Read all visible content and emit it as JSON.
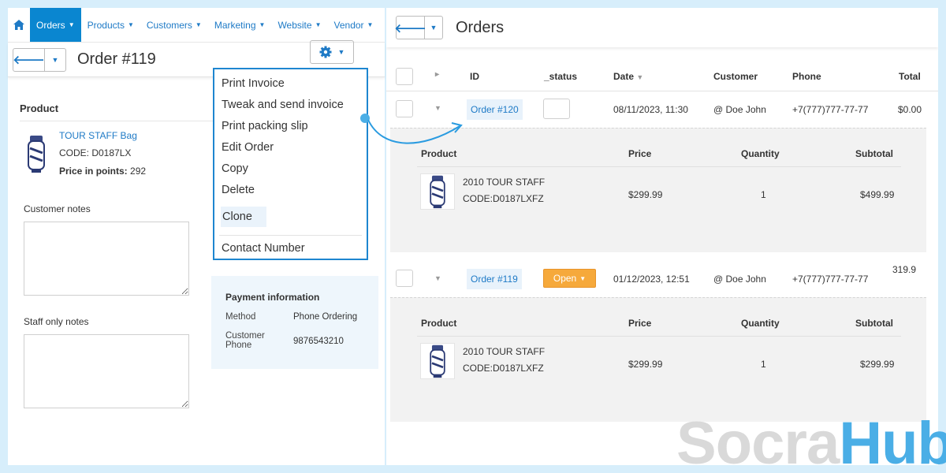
{
  "nav": {
    "items": [
      {
        "label": "Orders",
        "active": true
      },
      {
        "label": "Products"
      },
      {
        "label": "Customers"
      },
      {
        "label": "Marketing"
      },
      {
        "label": "Website"
      },
      {
        "label": "Vendor"
      }
    ]
  },
  "order_header": {
    "title": "Order #119"
  },
  "product": {
    "section_label": "Product",
    "name": "TOUR STAFF Bag",
    "code": "CODE: D0187LX",
    "points_label": "Price in points:",
    "points_value": "292"
  },
  "notes": {
    "customer_label": "Customer notes",
    "staff_label": "Staff only notes"
  },
  "payment": {
    "title": "Payment information",
    "method_label": "Method",
    "method_value": "Phone Ordering",
    "phone_label_1": "Customer",
    "phone_label_2": "Phone",
    "phone_value": "9876543210"
  },
  "dropdown": {
    "items": [
      "Print Invoice",
      "Tweak and send invoice",
      "Print packing slip",
      "Edit Order",
      "Copy",
      "Delete"
    ],
    "highlighted": "Clone",
    "after_sep": "Contact Number"
  },
  "orders": {
    "title": "Orders",
    "columns": {
      "id": "ID",
      "status": "_status",
      "date": "Date",
      "customer": "Customer",
      "phone": "Phone",
      "total": "Total"
    },
    "rows": [
      {
        "id": "Order #120",
        "status": "",
        "date": "08/11/2023, 11:30",
        "customer": "@ Doe John",
        "phone": "+7(777)777-77-77",
        "total": "$0.00",
        "detail": {
          "headers": {
            "product": "Product",
            "price": "Price",
            "quantity": "Quantity",
            "subtotal": "Subtotal"
          },
          "product_name": "2010 TOUR STAFF",
          "product_code": "CODE:D0187LXFZ",
          "price": "$299.99",
          "quantity": "1",
          "subtotal": "$499.99"
        }
      },
      {
        "id": "Order #119",
        "status": "Open",
        "date": "01/12/2023, 12:51",
        "customer": "@ Doe John",
        "phone": "+7(777)777-77-77",
        "total": "319.9",
        "detail": {
          "headers": {
            "product": "Product",
            "price": "Price",
            "quantity": "Quantity",
            "subtotal": "Subtotal"
          },
          "product_name": "2010 TOUR STAFF",
          "product_code": "CODE:D0187LXFZ",
          "price": "$299.99",
          "quantity": "1",
          "subtotal": "$299.99"
        }
      }
    ]
  },
  "watermark": {
    "part1": "Socra",
    "part2": "Hub"
  },
  "colors": {
    "accent": "#0a86d0",
    "link": "#1e7ac6",
    "open": "#f6a93b",
    "background": "#d7eefb"
  }
}
